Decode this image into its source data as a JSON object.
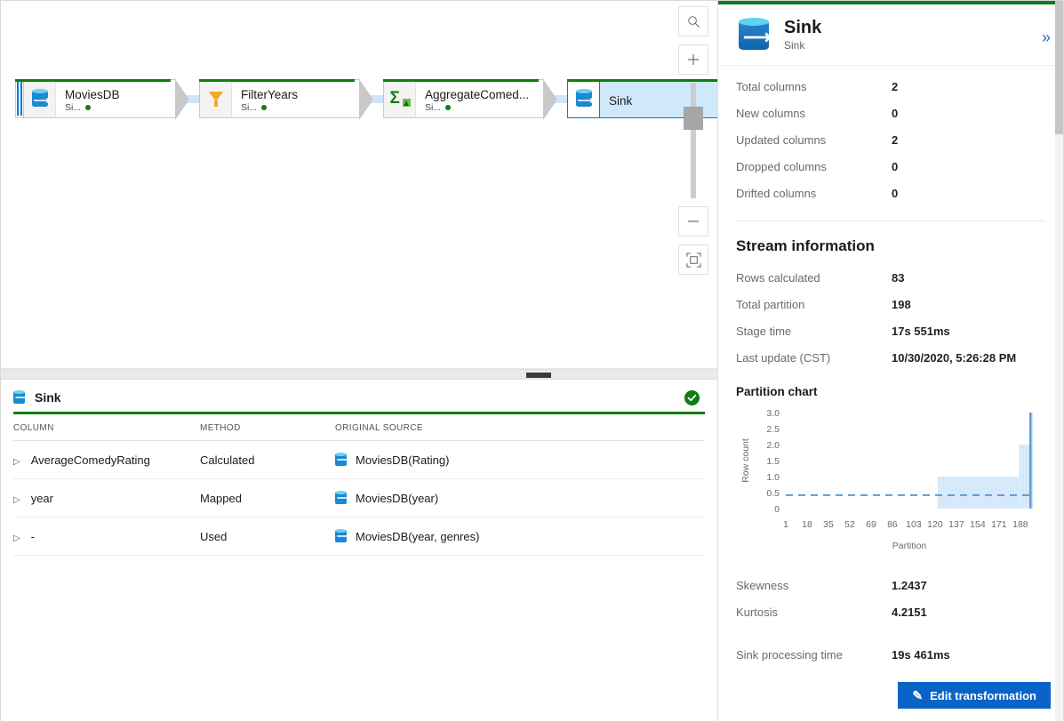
{
  "flow": {
    "nodes": [
      {
        "name": "MoviesDB",
        "subtitle": "Si...",
        "icon": "database-source-icon",
        "kind": "source",
        "selected": false,
        "status": "ok"
      },
      {
        "name": "FilterYears",
        "subtitle": "Si...",
        "icon": "funnel-filter-icon",
        "kind": "filter",
        "selected": false,
        "status": "ok"
      },
      {
        "name": "AggregateComed...",
        "subtitle": "Si...",
        "icon": "sigma-aggregate-icon",
        "kind": "aggregate",
        "selected": false,
        "status": "ok"
      },
      {
        "name": "Sink",
        "subtitle": "",
        "icon": "database-sink-icon",
        "kind": "sink",
        "selected": true,
        "status": "ok"
      }
    ]
  },
  "canvas_tools": {
    "search_label": "search-canvas",
    "zoom_in_label": "+",
    "zoom_out_label": "–",
    "fit_label": "fit-to-screen"
  },
  "bottom_panel": {
    "title": "Sink",
    "status": "ok",
    "columns": [
      "COLUMN",
      "METHOD",
      "ORIGINAL SOURCE"
    ],
    "rows": [
      {
        "column": "AverageComedyRating",
        "method": "Calculated",
        "source": "MoviesDB(Rating)"
      },
      {
        "column": "year",
        "method": "Mapped",
        "source": "MoviesDB(year)"
      },
      {
        "column": "-",
        "method": "Used",
        "source": "MoviesDB(year, genres)"
      }
    ]
  },
  "details": {
    "title": "Sink",
    "subtitle": "Sink",
    "collapse_glyph": "»",
    "column_stats": [
      {
        "label": "Total columns",
        "value": "2"
      },
      {
        "label": "New columns",
        "value": "0"
      },
      {
        "label": "Updated columns",
        "value": "2"
      },
      {
        "label": "Dropped columns",
        "value": "0"
      },
      {
        "label": "Drifted columns",
        "value": "0"
      }
    ],
    "stream_information": {
      "heading": "Stream information",
      "items": [
        {
          "label": "Rows calculated",
          "value": "83"
        },
        {
          "label": "Total partition",
          "value": "198"
        },
        {
          "label": "Stage time",
          "value": "17s 551ms"
        },
        {
          "label": "Last update (CST)",
          "value": "10/30/2020, 5:26:28 PM"
        }
      ]
    },
    "distribution_stats": [
      {
        "label": "Skewness",
        "value": "1.2437"
      },
      {
        "label": "Kurtosis",
        "value": "4.2151"
      }
    ],
    "processing": [
      {
        "label": "Sink processing time",
        "value": "19s 461ms"
      }
    ],
    "edit_button": "Edit transformation"
  },
  "chart_data": {
    "type": "bar",
    "title": "Partition chart",
    "xlabel": "Partition",
    "ylabel": "Row count",
    "xticks": [
      1,
      18,
      35,
      52,
      69,
      86,
      103,
      120,
      137,
      154,
      171,
      188
    ],
    "yticks": [
      "0",
      "0.5",
      "1.0",
      "1.5",
      "2.0",
      "2.5",
      "3.0"
    ],
    "ylim": [
      0,
      3.0
    ],
    "xlim": [
      1,
      198
    ],
    "grid": false,
    "legend": "none",
    "average_line": {
      "value": 0.42,
      "style": "dashed",
      "color": "#5b9bd5"
    },
    "bar_color": "#d3e7fa",
    "spike_color": "#5b9bd5",
    "segments": [
      {
        "from": 1,
        "to": 121,
        "value": 0
      },
      {
        "from": 122,
        "to": 186,
        "value": 1.0
      },
      {
        "from": 187,
        "to": 194,
        "value": 2.0
      },
      {
        "from": 195,
        "to": 197,
        "value": 3.0
      }
    ]
  }
}
